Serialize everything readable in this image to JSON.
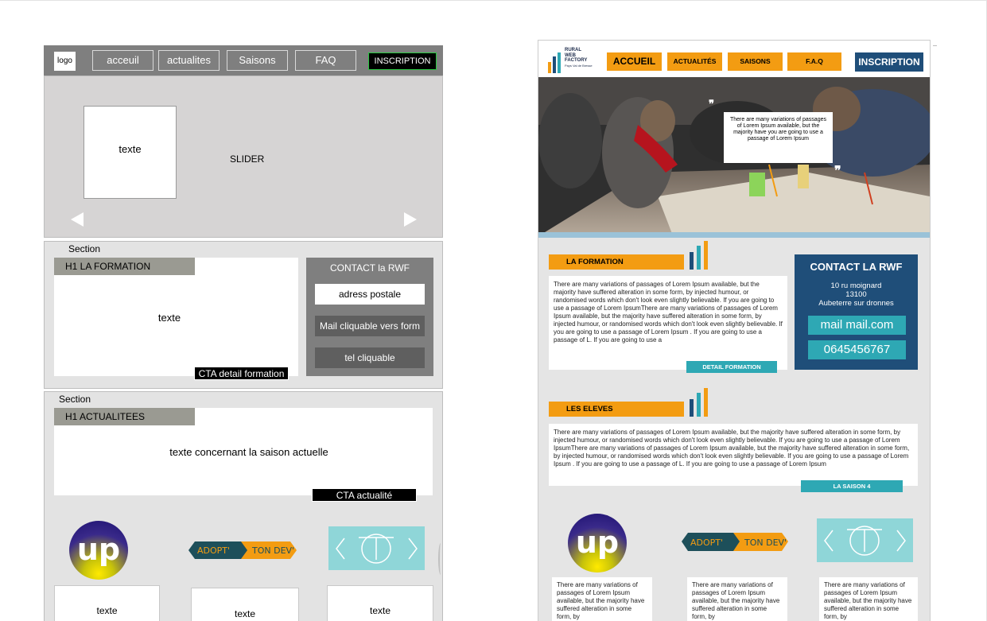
{
  "wireframe": {
    "nav": {
      "logo": "logo",
      "items": [
        "acceuil",
        "actualites",
        "Saisons",
        "FAQ"
      ],
      "cta": "INSCRIPTION"
    },
    "slider": {
      "box_text": "texte",
      "label": "SLIDER"
    },
    "section1": {
      "label": "Section",
      "heading": "H1 LA FORMATION",
      "body": "texte",
      "cta": "CTA detail formation",
      "contact": {
        "title": "CONTACT la RWF",
        "address": "adress postale",
        "mail": "Mail cliquable vers form",
        "tel": "tel cliquable"
      }
    },
    "section2": {
      "label": "Section",
      "heading": "H1 ACTUALITEES",
      "body": "texte concernant la saison actuelle",
      "cta": "CTA actualité",
      "cards": [
        "texte",
        "texte",
        "texte"
      ]
    }
  },
  "mockup": {
    "nav": {
      "logo_lines": [
        "RURAL",
        "WEB",
        "FACTORY",
        "Pays Val de Bresse"
      ],
      "items": [
        "ACCUEIL",
        "ACTUALITÉS",
        "SAISONS",
        "F.A.Q"
      ],
      "cta": "INSCRIPTION"
    },
    "hero": {
      "caption": "There are many variations of passages of Lorem Ipsum available, but the majority have you are going to use a passage of Lorem Ipsum"
    },
    "formation": {
      "title": "LA FORMATION",
      "text": "There are many variations of passages of Lorem Ipsum available, but the majority have suffered alteration in some form, by injected humour, or randomised words which don't look even slightly believable. If you are going to use a passage of Lorem IpsumThere are many variations of passages of Lorem Ipsum available, but the majority have suffered alteration in some form, by injected humour, or randomised words which don't look even slightly believable. If you are going to use a passage of Lorem Ipsum\n. If you are going to use a passage of L. If you are going to use a",
      "cta": "DETAIL FORMATION"
    },
    "contact": {
      "title": "CONTACT LA RWF",
      "address": [
        "10 ru moignard",
        "13100",
        "Aubeterre sur dronnes"
      ],
      "mail": "mail mail.com",
      "tel": "0645456767"
    },
    "eleves": {
      "title": "LES ELEVES",
      "text": "There are many variations of passages of Lorem Ipsum available, but the majority have suffered alteration in some form, by injected humour, or randomised words which don't look even slightly believable. If you are going to use a passage of Lorem IpsumThere are many variations of passages of Lorem Ipsum available, but the majority have suffered alteration in some form, by injected humour, or randomised words which don't look even slightly believable. If you are going to use a passage of Lorem Ipsum\n. If you are going to use a passage of L. If you are going to use a passage of Lorem Ipsum",
      "cta": "LA SAISON 4"
    },
    "partners": {
      "up_logo": "up",
      "adopt_left": "ADOPT'",
      "adopt_right": "TON DEV'"
    },
    "cards": [
      "There are many variations of passages of Lorem Ipsum available, but the majority have suffered alteration in some form, by",
      "There are many variations of passages of Lorem Ipsum available, but the majority have suffered alteration in some form, by",
      "There are many variations of passages of Lorem Ipsum available, but the majority have suffered alteration in some form, by"
    ]
  },
  "colors": {
    "orange": "#f39c12",
    "navy": "#1f4e79",
    "teal": "#2ea8b4",
    "wire_gray": "#7f7f7f"
  }
}
